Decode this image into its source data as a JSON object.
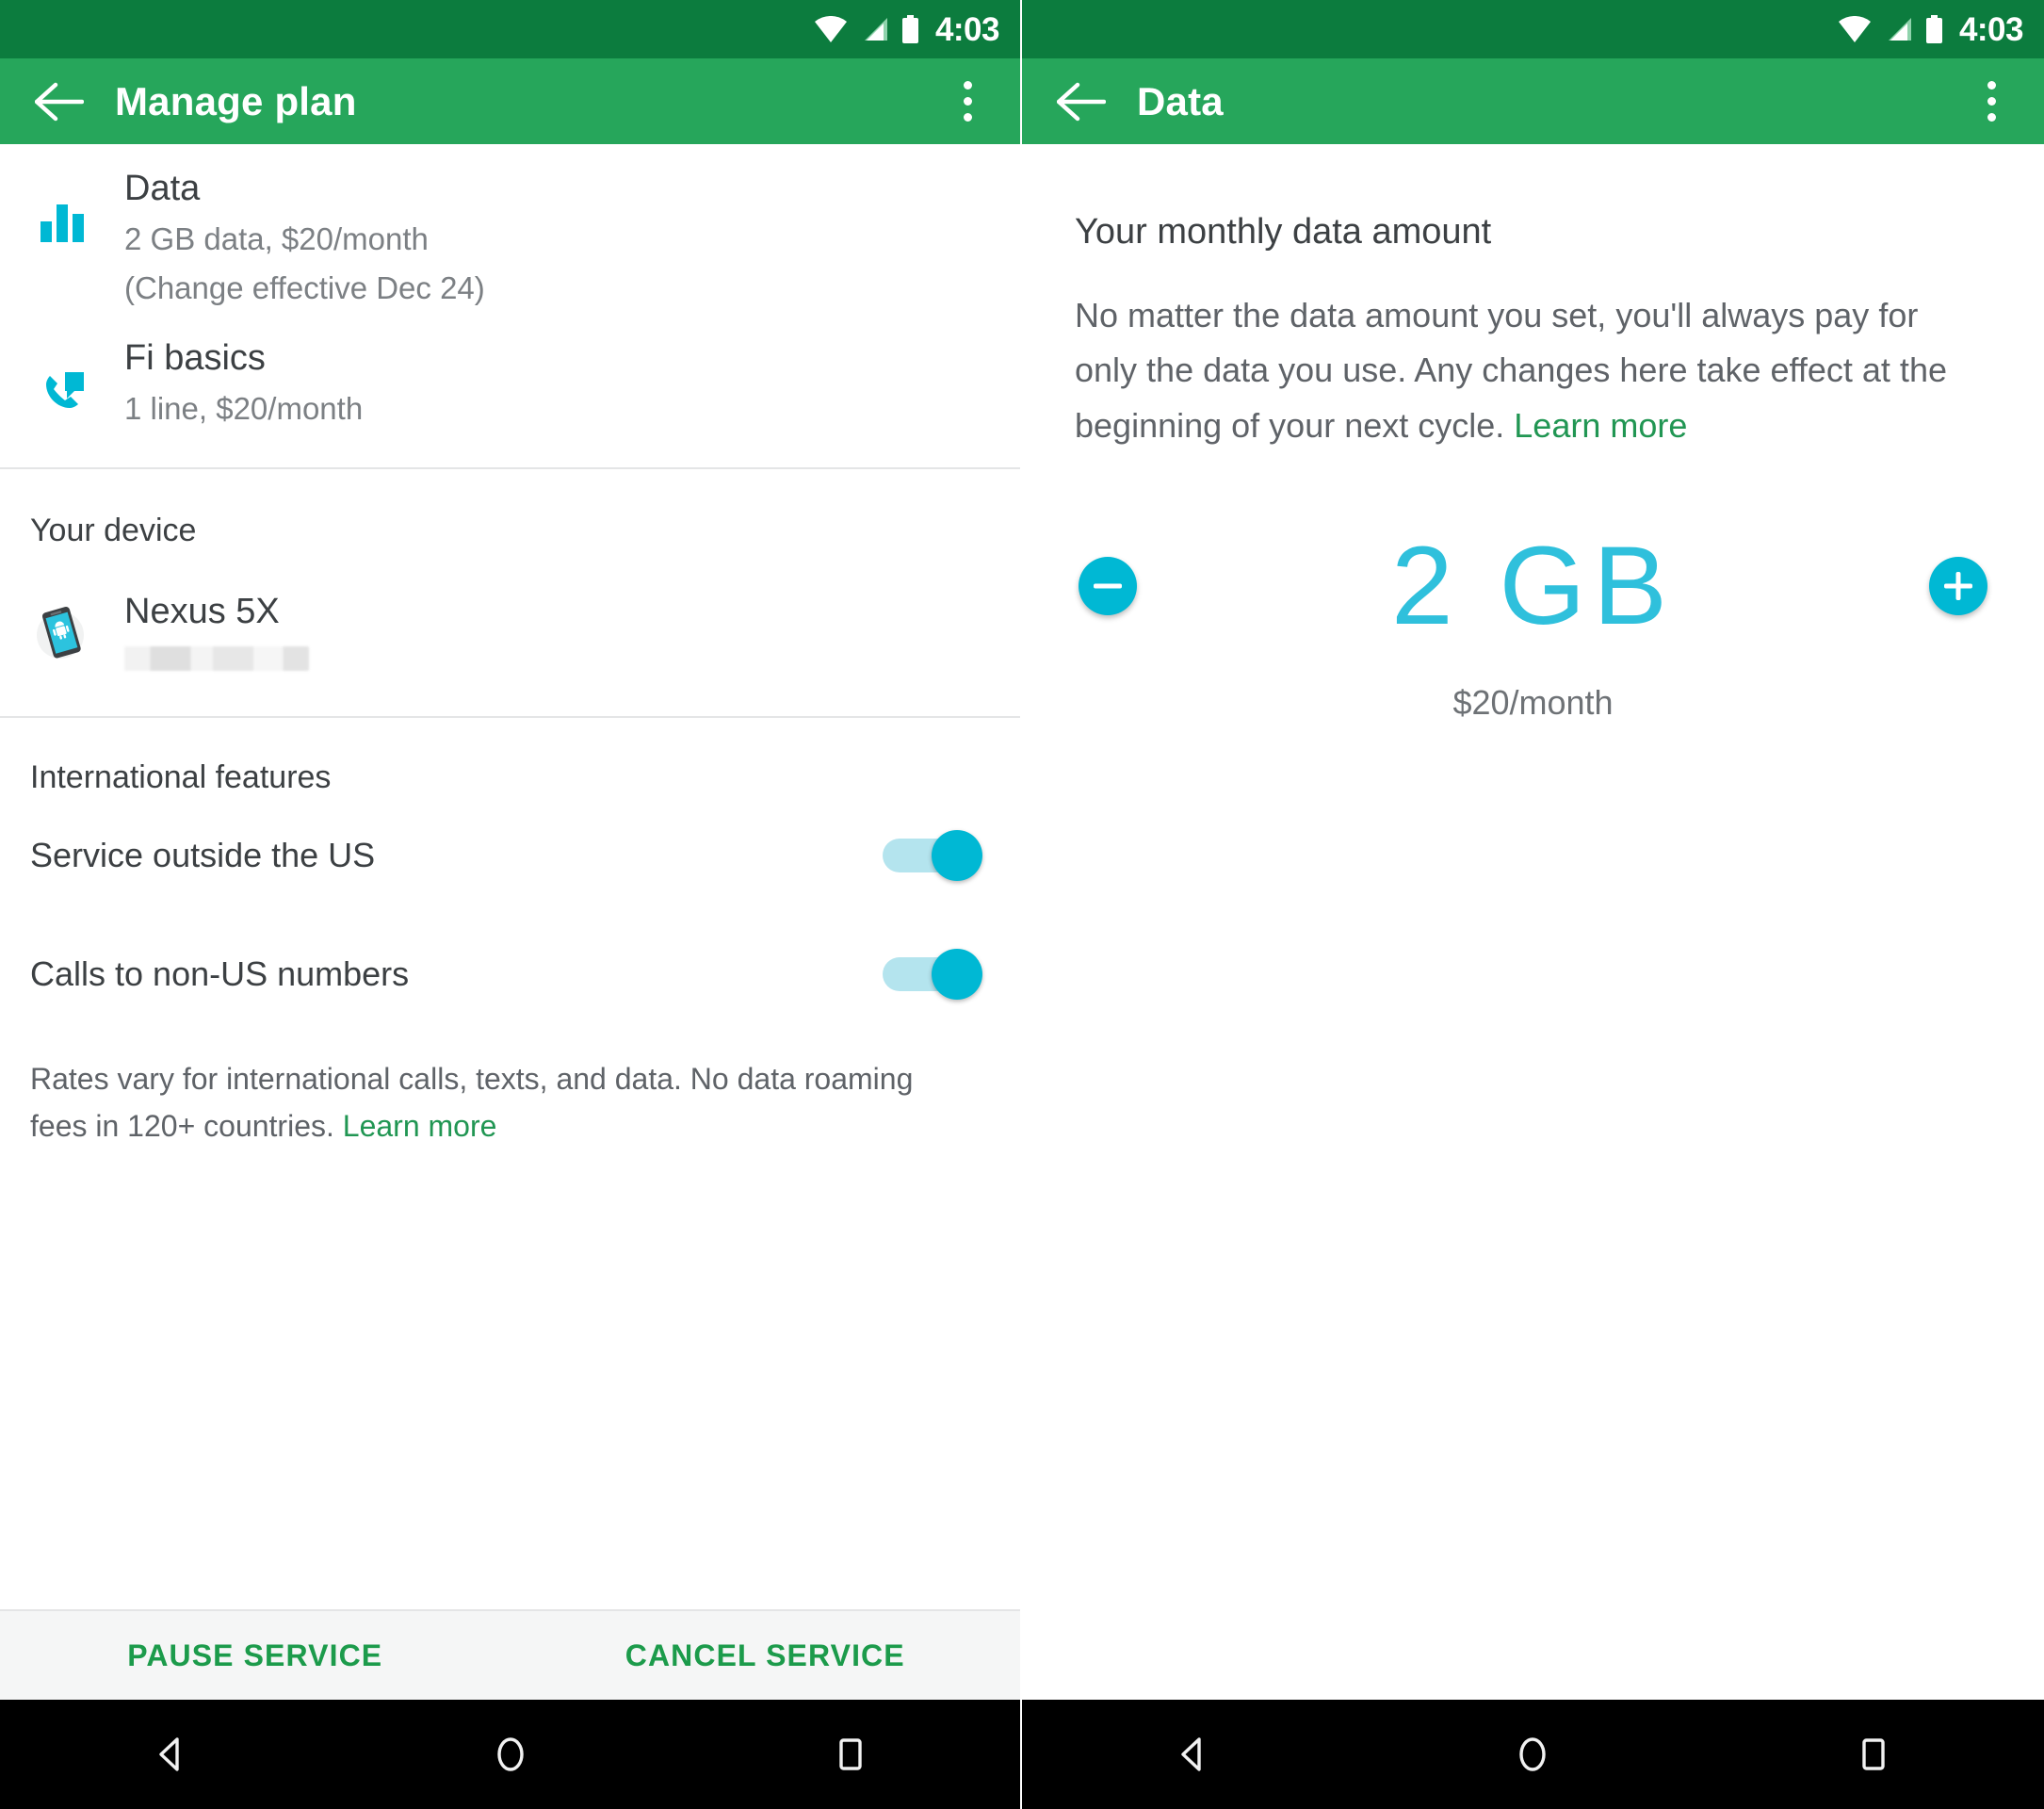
{
  "status_bar": {
    "time": "4:03",
    "icons": [
      "wifi-icon",
      "signal-icon",
      "battery-icon"
    ]
  },
  "colors": {
    "status_bar_green": "#0C7C3E",
    "app_bar_green": "#26A65B",
    "accent_cyan": "#00B8D4",
    "link_green": "#219653",
    "action_green": "#1C9B4B",
    "data_amount_cyan": "#2FC0DC",
    "toggle_track": "#B4E4EE"
  },
  "left_screen": {
    "app_bar": {
      "title": "Manage plan",
      "back_icon": "back-arrow-icon",
      "overflow_icon": "overflow-menu-icon"
    },
    "plan_rows": [
      {
        "icon": "bar-chart-icon",
        "title": "Data",
        "sub1": "2 GB data, $20/month",
        "sub2": "(Change effective Dec 24)"
      },
      {
        "icon": "phone-call-icon",
        "title": "Fi basics",
        "sub1": "1 line, $20/month",
        "sub2": ""
      }
    ],
    "device_section": {
      "heading": "Your device",
      "icon": "android-phone-icon",
      "device_name": "Nexus 5X",
      "phone_number_redacted": true
    },
    "international": {
      "heading": "International features",
      "toggles": [
        {
          "label": "Service outside the US",
          "on": true
        },
        {
          "label": "Calls to non-US numbers",
          "on": true
        }
      ],
      "rates_text": "Rates vary for international calls, texts, and data. No data roaming fees in 120+ countries. ",
      "rates_link": "Learn more"
    },
    "actions": {
      "pause_label": "PAUSE SERVICE",
      "cancel_label": "CANCEL SERVICE"
    }
  },
  "right_screen": {
    "app_bar": {
      "title": "Data",
      "back_icon": "back-arrow-icon",
      "overflow_icon": "overflow-menu-icon"
    },
    "heading": "Your monthly data amount",
    "description": "No matter the data amount you set, you'll always pay for only the data you use. Any changes here take effect at the beginning of your next cycle. ",
    "description_link": "Learn more",
    "stepper": {
      "decrease_icon": "minus-circle-icon",
      "increase_icon": "plus-circle-icon",
      "amount": "2 GB",
      "price": "$20/month"
    }
  },
  "nav_bar": {
    "back": "nav-back-icon",
    "home": "nav-home-icon",
    "recents": "nav-recents-icon"
  }
}
